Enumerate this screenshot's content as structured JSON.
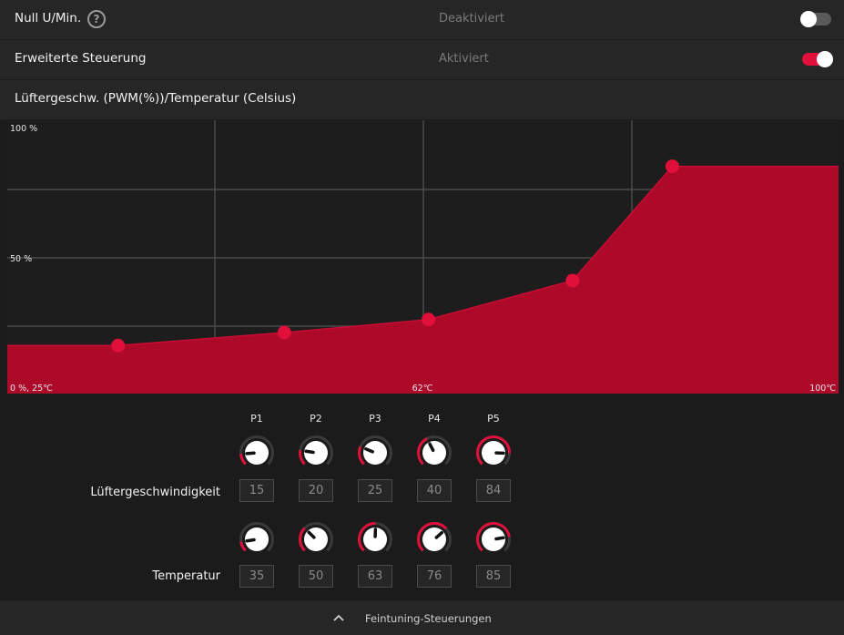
{
  "zero_rpm": {
    "label": "Null U/Min.",
    "help_icon": "?",
    "status": "Deaktiviert",
    "enabled": false
  },
  "advanced_control": {
    "label": "Erweiterte Steuerung",
    "status": "Aktiviert",
    "enabled": true
  },
  "curve_title": "Lüftergeschw. (PWM(%))/Temperatur (Celsius)",
  "colors": {
    "accent": "#e0103a",
    "fill": "#ad0a2a",
    "grid": "#4a4a4a",
    "track": "#3a3a3a"
  },
  "chart_data": {
    "type": "area",
    "y_tick_labels": [
      "100 %",
      "50 %"
    ],
    "origin_label": "0 %, 25℃",
    "x_mid_label": "62℃",
    "x_max_label": "100℃",
    "ylim": [
      0,
      100
    ],
    "xlim": [
      25,
      100
    ],
    "points": [
      {
        "name": "P1",
        "temp": 35,
        "speed": 15
      },
      {
        "name": "P2",
        "temp": 50,
        "speed": 20
      },
      {
        "name": "P3",
        "temp": 63,
        "speed": 25
      },
      {
        "name": "P4",
        "temp": 76,
        "speed": 40
      },
      {
        "name": "P5",
        "temp": 85,
        "speed": 84
      }
    ],
    "grid": true
  },
  "tuning": {
    "columns": [
      "P1",
      "P2",
      "P3",
      "P4",
      "P5"
    ],
    "fan_speed_label": "Lüftergeschwindigkeit",
    "temperature_label": "Temperatur",
    "fan_speed_values": [
      "15",
      "20",
      "25",
      "40",
      "84"
    ],
    "temperature_values": [
      "35",
      "50",
      "63",
      "76",
      "85"
    ]
  },
  "footer": {
    "label": "Feintuning-Steuerungen",
    "icon": "chevron-up-icon"
  }
}
